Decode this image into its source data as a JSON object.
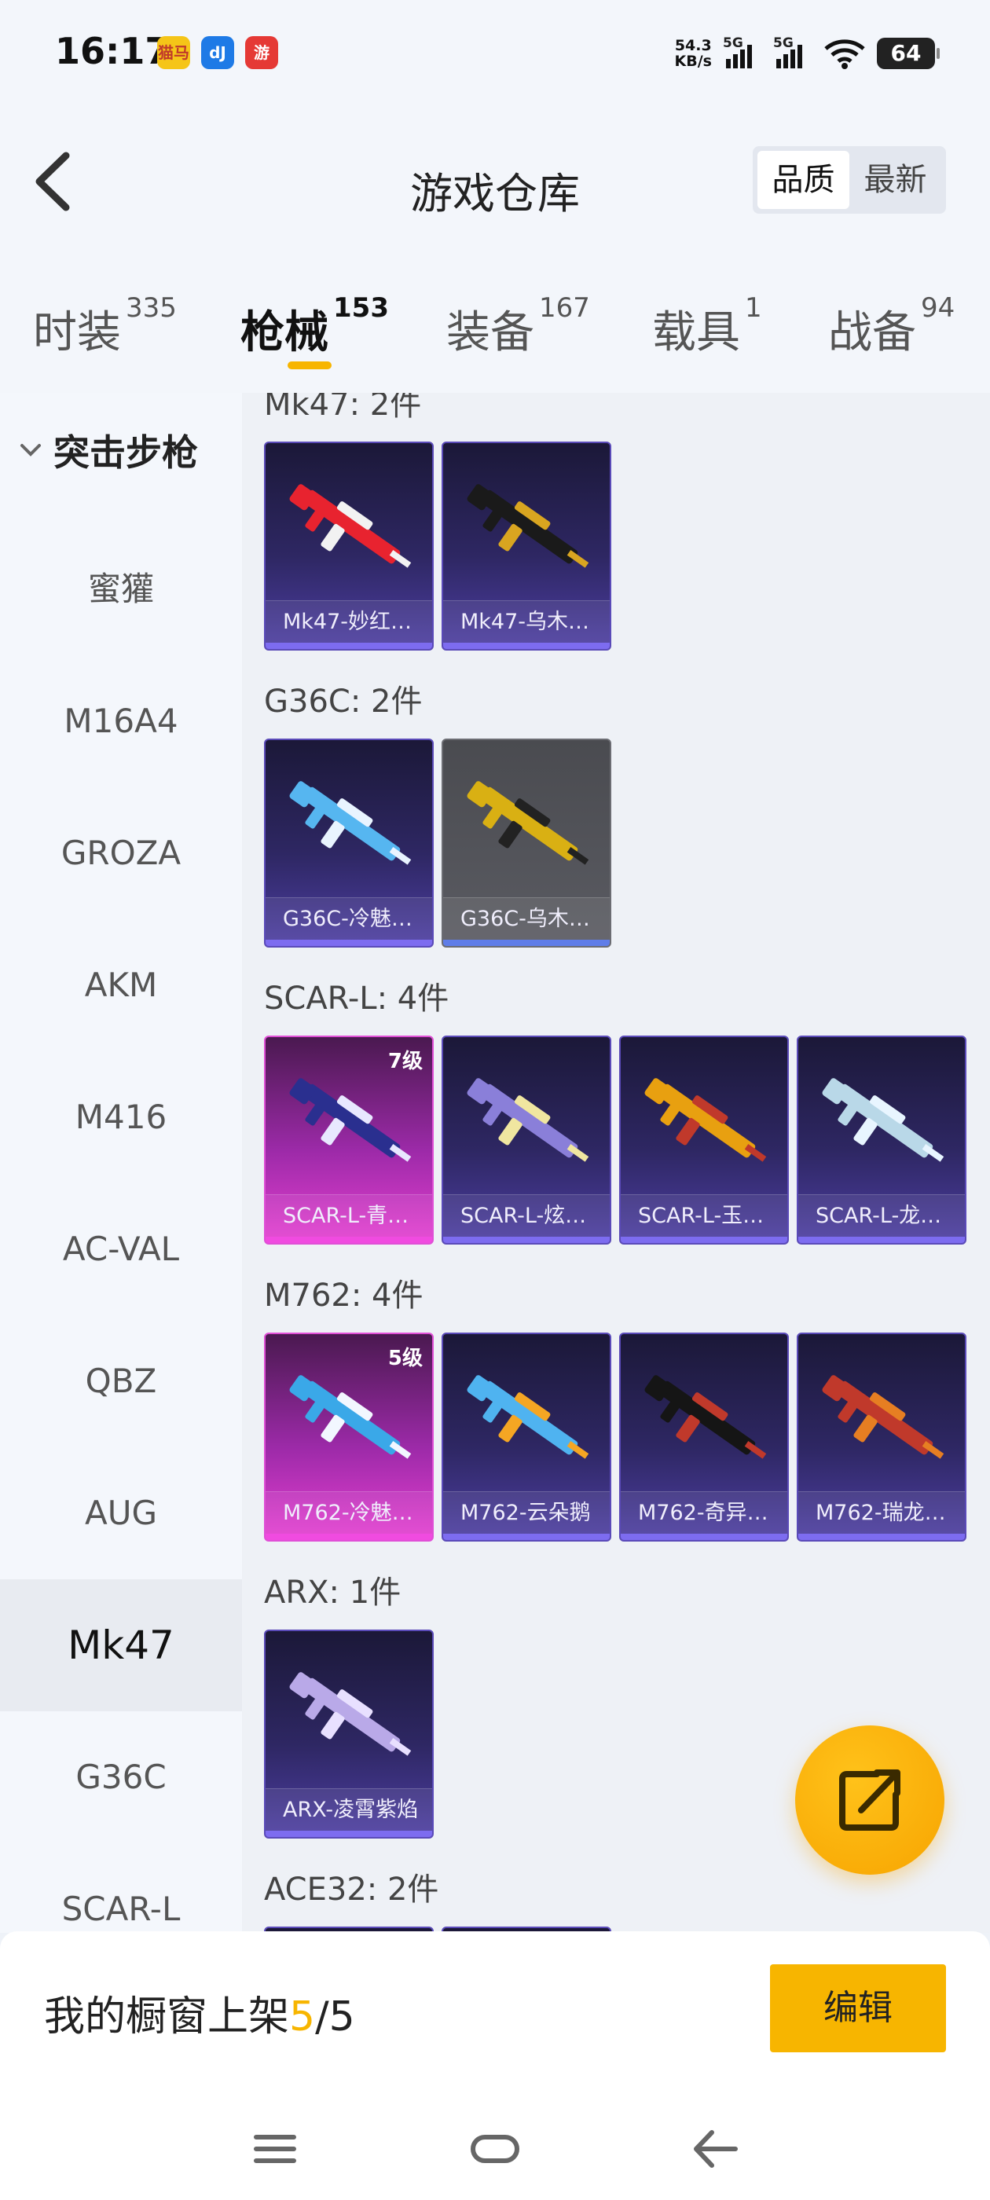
{
  "status_bar": {
    "time": "16:17",
    "app_icons": [
      {
        "name": "maomao-app-icon",
        "label": "猫马",
        "color": "#f5c518"
      },
      {
        "name": "tool-app-icon",
        "label": "dJ",
        "color": "#1e7ae6"
      },
      {
        "name": "red-app-icon",
        "label": "游",
        "color": "#e53935"
      }
    ],
    "net_speed_value": "54.3",
    "net_speed_unit": "KB/s",
    "signal_1": "5G",
    "signal_2": "5G",
    "battery": "64"
  },
  "header": {
    "title": "游戏仓库",
    "sort_options": [
      "品质",
      "最新"
    ],
    "active_sort": "品质"
  },
  "tabs": [
    {
      "label": "时装",
      "count": "335"
    },
    {
      "label": "枪械",
      "count": "153"
    },
    {
      "label": "装备",
      "count": "167"
    },
    {
      "label": "载具",
      "count": "1"
    },
    {
      "label": "战备",
      "count": "94"
    }
  ],
  "active_tab": "枪械",
  "sidebar": {
    "category": "突击步枪",
    "items": [
      "蜜獾",
      "M16A4",
      "GROZA",
      "AKM",
      "M416",
      "AC-VAL",
      "QBZ",
      "AUG",
      "Mk47",
      "G36C",
      "SCAR-L"
    ],
    "active_item": "Mk47"
  },
  "groups": [
    {
      "title": "Mk47: 2件",
      "items": [
        {
          "name": "Mk47-妙红…",
          "rarity": "epic",
          "colors": [
            "#e8232f",
            "#f2f2f2"
          ]
        },
        {
          "name": "Mk47-乌木…",
          "rarity": "epic",
          "colors": [
            "#1a1a1a",
            "#d9a520"
          ]
        }
      ]
    },
    {
      "title": "G36C: 2件",
      "items": [
        {
          "name": "G36C-冷魅…",
          "rarity": "epic",
          "colors": [
            "#56b6f0",
            "#e9f4ff"
          ]
        },
        {
          "name": "G36C-乌木…",
          "rarity": "common",
          "colors": [
            "#d9b013",
            "#222222"
          ]
        }
      ]
    },
    {
      "title": "SCAR-L: 4件",
      "items": [
        {
          "name": "SCAR-L-青…",
          "rarity": "legend",
          "level": "7级",
          "colors": [
            "#2a2f8f",
            "#e8e8ff"
          ]
        },
        {
          "name": "SCAR-L-炫…",
          "rarity": "epic",
          "colors": [
            "#8a7fd9",
            "#f0e6a0"
          ]
        },
        {
          "name": "SCAR-L-玉…",
          "rarity": "epic",
          "colors": [
            "#e8a010",
            "#c0392b"
          ]
        },
        {
          "name": "SCAR-L-龙…",
          "rarity": "epic",
          "colors": [
            "#b9d8e8",
            "#e8f5ff"
          ]
        }
      ]
    },
    {
      "title": "M762: 4件",
      "items": [
        {
          "name": "M762-冷魅…",
          "rarity": "legend",
          "level": "5级",
          "colors": [
            "#3aa8e8",
            "#f2f7ff"
          ]
        },
        {
          "name": "M762-云朵鹅",
          "rarity": "epic",
          "colors": [
            "#4fb3f0",
            "#f5a623"
          ]
        },
        {
          "name": "M762-奇异…",
          "rarity": "epic",
          "colors": [
            "#151515",
            "#c0392b"
          ]
        },
        {
          "name": "M762-瑞龙…",
          "rarity": "epic",
          "colors": [
            "#c0392b",
            "#e67e22"
          ]
        }
      ]
    },
    {
      "title": "ARX: 1件",
      "items": [
        {
          "name": "ARX-凌霄紫焰",
          "rarity": "epic",
          "colors": [
            "#b9a9e8",
            "#e8e0ff"
          ]
        }
      ]
    },
    {
      "title": "ACE32: 2件",
      "items": []
    }
  ],
  "bottom_bar": {
    "shelf_prefix": "我的橱窗上架",
    "shelf_count": "5",
    "shelf_sep": "/",
    "shelf_total": "5",
    "edit_label": "编辑"
  },
  "nav_bar": {
    "icons": [
      "menu-icon",
      "home-icon",
      "back-icon"
    ]
  }
}
